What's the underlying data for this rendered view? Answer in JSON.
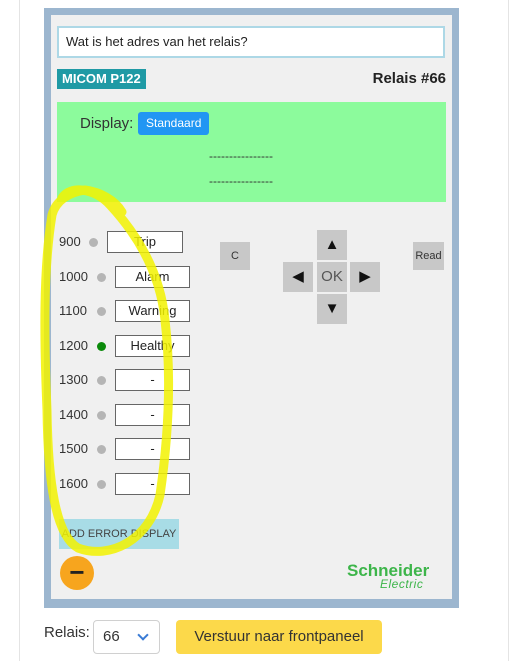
{
  "question": "Wat is het adres van het relais?",
  "model": "MICOM P122",
  "relay_title": "Relais #66",
  "display": {
    "label": "Display:",
    "mode_button": "Standaard",
    "line1": "----------------",
    "line2": "----------------"
  },
  "leds": [
    {
      "code": "900",
      "text": "Trip",
      "state": "off"
    },
    {
      "code": "1000",
      "text": "Alarm",
      "state": "off"
    },
    {
      "code": "1100",
      "text": "Warning",
      "state": "off"
    },
    {
      "code": "1200",
      "text": "Healthy",
      "state": "on"
    },
    {
      "code": "1300",
      "text": "-",
      "state": "off"
    },
    {
      "code": "1400",
      "text": "-",
      "state": "off"
    },
    {
      "code": "1500",
      "text": "-",
      "state": "off"
    },
    {
      "code": "1600",
      "text": "-",
      "state": "off"
    }
  ],
  "keys": {
    "c": "C",
    "read": "Read",
    "ok": "OK",
    "up": "▲",
    "down": "▼",
    "left": "◀",
    "right": "▶"
  },
  "add_error_display": "ADD ERROR DISPLAY",
  "minus": "−",
  "logo": {
    "line1": "Schneider",
    "line2": "Electric"
  },
  "footer": {
    "relais_label": "Relais:",
    "relais_value": "66",
    "submit": "Verstuur naar frontpaneel"
  },
  "colors": {
    "display_bg": "#8cfb9c",
    "highlight": "#f2f200",
    "led_on": "#0a8a0a",
    "led_off": "#b5b5b5"
  }
}
